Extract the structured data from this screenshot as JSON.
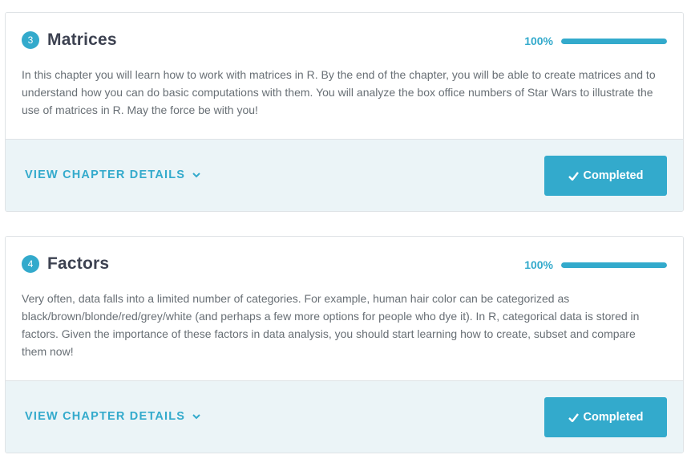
{
  "colors": {
    "accent": "#33aacc",
    "title": "#3d4251",
    "text": "#686f75",
    "footer_bg": "#ebf4f7"
  },
  "chapters": [
    {
      "number": "3",
      "title": "Matrices",
      "progress_label": "100%",
      "progress_value": 100,
      "description": "In this chapter you will learn how to work with matrices in R. By the end of the chapter, you will be able to create matrices and to understand how you can do basic computations with them. You will analyze the box office numbers of Star Wars to illustrate the use of matrices in R. May the force be with you!",
      "details_label": "VIEW CHAPTER DETAILS",
      "details_icon": "chevron-down-icon",
      "status_label": "Completed",
      "status_icon": "checkmark-icon"
    },
    {
      "number": "4",
      "title": "Factors",
      "progress_label": "100%",
      "progress_value": 100,
      "description": "Very often, data falls into a limited number of categories. For example, human hair color can be categorized as black/brown/blonde/red/grey/white (and perhaps a few more options for people who dye it). In R, categorical data is stored in factors. Given the importance of these factors in data analysis, you should start learning how to create, subset and compare them now!",
      "details_label": "VIEW CHAPTER DETAILS",
      "details_icon": "chevron-down-icon",
      "status_label": "Completed",
      "status_icon": "checkmark-icon"
    }
  ]
}
